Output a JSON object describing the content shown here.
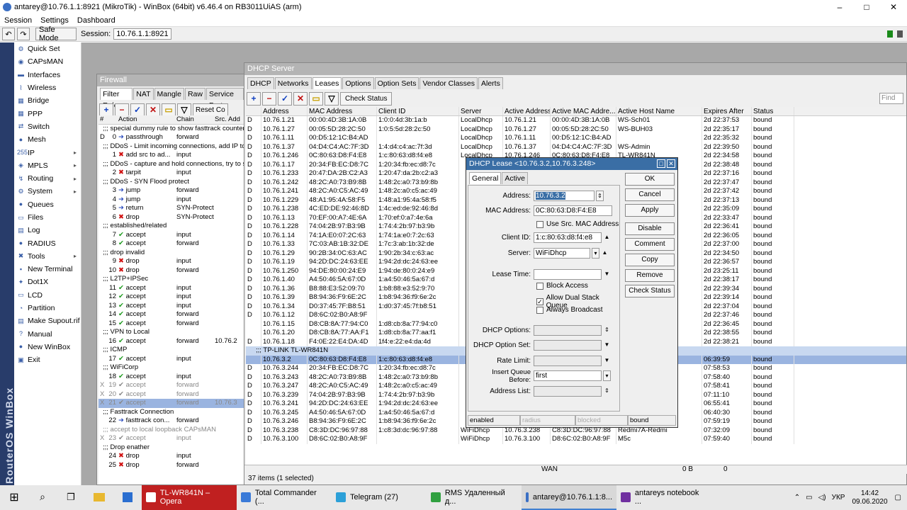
{
  "window": {
    "title": "antarey@10.76.1.1:8921 (MikroTik) - WinBox (64bit) v6.46.4 on RB3011UiAS (arm)",
    "minimize": "–",
    "maximize": "□",
    "close": "✕"
  },
  "menu": {
    "session": "Session",
    "settings": "Settings",
    "dashboard": "Dashboard"
  },
  "toolbar": {
    "undo": "↶",
    "redo": "↷",
    "safe_mode": "Safe Mode",
    "session_label": "Session:",
    "session_value": "10.76.1.1:8921"
  },
  "brand": "RouterOS WinBox",
  "sidebar": {
    "items": [
      {
        "label": "Quick Set",
        "icon": "quick-set-icon",
        "sym": "⚙"
      },
      {
        "label": "CAPsMAN",
        "icon": "capsman-icon",
        "sym": "◉"
      },
      {
        "label": "Interfaces",
        "icon": "interfaces-icon",
        "sym": "▬"
      },
      {
        "label": "Wireless",
        "icon": "wireless-icon",
        "sym": "⌇"
      },
      {
        "label": "Bridge",
        "icon": "bridge-icon",
        "sym": "▦"
      },
      {
        "label": "PPP",
        "icon": "ppp-icon",
        "sym": "▦"
      },
      {
        "label": "Switch",
        "icon": "switch-icon",
        "sym": "⇄"
      },
      {
        "label": "Mesh",
        "icon": "mesh-icon",
        "sym": "●"
      },
      {
        "label": "IP",
        "icon": "ip-icon",
        "sym": "255",
        "arrow": "▸"
      },
      {
        "label": "MPLS",
        "icon": "mpls-icon",
        "sym": "◈",
        "arrow": "▸"
      },
      {
        "label": "Routing",
        "icon": "routing-icon",
        "sym": "↯",
        "arrow": "▸"
      },
      {
        "label": "System",
        "icon": "system-icon",
        "sym": "⚙",
        "arrow": "▸"
      },
      {
        "label": "Queues",
        "icon": "queues-icon",
        "sym": "●"
      },
      {
        "label": "Files",
        "icon": "files-icon",
        "sym": "▭"
      },
      {
        "label": "Log",
        "icon": "log-icon",
        "sym": "▤"
      },
      {
        "label": "RADIUS",
        "icon": "radius-icon",
        "sym": "●"
      },
      {
        "label": "Tools",
        "icon": "tools-icon",
        "sym": "✖",
        "arrow": "▸"
      },
      {
        "label": "New Terminal",
        "icon": "terminal-icon",
        "sym": "▪"
      },
      {
        "label": "Dot1X",
        "icon": "dot1x-icon",
        "sym": "✦"
      },
      {
        "label": "LCD",
        "icon": "lcd-icon",
        "sym": "▭"
      },
      {
        "label": "Partition",
        "icon": "partition-icon",
        "sym": "◔"
      },
      {
        "label": "Make Supout.rif",
        "icon": "supout-icon",
        "sym": "▤"
      },
      {
        "label": "Manual",
        "icon": "manual-icon",
        "sym": "?"
      },
      {
        "label": "New WinBox",
        "icon": "new-winbox-icon",
        "sym": "●"
      },
      {
        "label": "Exit",
        "icon": "exit-icon",
        "sym": "▣"
      }
    ]
  },
  "firewall": {
    "title": "Firewall",
    "tabs": [
      "Filter Rules",
      "NAT",
      "Mangle",
      "Raw",
      "Service Ports"
    ],
    "reset": "Reset Co",
    "headers": {
      "hash": "#",
      "action": "Action",
      "chain": "Chain",
      "src": "Src. Add"
    },
    "rows": [
      {
        "kind": "comment",
        "text": ";;; special dummy rule to show fasttrack counters"
      },
      {
        "flag": "D",
        "num": "0",
        "action": "passthrough",
        "chain": "forward",
        "src": "",
        "cls": "act-other"
      },
      {
        "kind": "comment",
        "text": ";;; DDoS - Limit incoming connections, add IP to"
      },
      {
        "flag": "",
        "num": "1",
        "action": "add src to ad...",
        "chain": "input",
        "src": "",
        "cls": "act-drop"
      },
      {
        "kind": "comment",
        "text": ";;; DDoS - capture and hold connections, try to s"
      },
      {
        "flag": "",
        "num": "2",
        "action": "tarpit",
        "chain": "input",
        "src": "",
        "cls": "act-drop"
      },
      {
        "kind": "comment",
        "text": ";;; DDoS - SYN Flood protect"
      },
      {
        "flag": "",
        "num": "3",
        "action": "jump",
        "chain": "forward",
        "src": "",
        "cls": "act-other"
      },
      {
        "flag": "",
        "num": "4",
        "action": "jump",
        "chain": "input",
        "src": "",
        "cls": "act-other"
      },
      {
        "flag": "",
        "num": "5",
        "action": "return",
        "chain": "SYN-Protect",
        "src": "",
        "cls": "act-other"
      },
      {
        "flag": "",
        "num": "6",
        "action": "drop",
        "chain": "SYN-Protect",
        "src": "",
        "cls": "act-drop"
      },
      {
        "kind": "comment",
        "text": ";;; established/related"
      },
      {
        "flag": "",
        "num": "7",
        "action": "accept",
        "chain": "input",
        "src": "",
        "cls": "act-acc"
      },
      {
        "flag": "",
        "num": "8",
        "action": "accept",
        "chain": "forward",
        "src": "",
        "cls": "act-acc"
      },
      {
        "kind": "comment",
        "text": ";;; drop invalid"
      },
      {
        "flag": "",
        "num": "9",
        "action": "drop",
        "chain": "input",
        "src": "",
        "cls": "act-drop"
      },
      {
        "flag": "",
        "num": "10",
        "action": "drop",
        "chain": "forward",
        "src": "",
        "cls": "act-drop"
      },
      {
        "kind": "comment",
        "text": ";;; L2TP+IPSec"
      },
      {
        "flag": "",
        "num": "11",
        "action": "accept",
        "chain": "input",
        "src": "",
        "cls": "act-acc"
      },
      {
        "flag": "",
        "num": "12",
        "action": "accept",
        "chain": "input",
        "src": "",
        "cls": "act-acc"
      },
      {
        "flag": "",
        "num": "13",
        "action": "accept",
        "chain": "input",
        "src": "",
        "cls": "act-acc"
      },
      {
        "flag": "",
        "num": "14",
        "action": "accept",
        "chain": "forward",
        "src": "",
        "cls": "act-acc"
      },
      {
        "flag": "",
        "num": "15",
        "action": "accept",
        "chain": "forward",
        "src": "",
        "cls": "act-acc"
      },
      {
        "kind": "comment",
        "text": ";;; VPN to Local"
      },
      {
        "flag": "",
        "num": "16",
        "action": "accept",
        "chain": "forward",
        "src": "10.76.2",
        "cls": "act-acc"
      },
      {
        "kind": "comment",
        "text": ";;; ICMP"
      },
      {
        "flag": "",
        "num": "17",
        "action": "accept",
        "chain": "input",
        "src": "",
        "cls": "act-acc"
      },
      {
        "kind": "comment",
        "text": ";;; WiFiCorp"
      },
      {
        "flag": "",
        "num": "18",
        "action": "accept",
        "chain": "input",
        "src": "",
        "cls": "act-acc"
      },
      {
        "flag": "X",
        "num": "19",
        "action": "accept",
        "chain": "forward",
        "src": "",
        "cls": "act-acc",
        "disabled": true
      },
      {
        "flag": "X",
        "num": "20",
        "action": "accept",
        "chain": "forward",
        "src": "",
        "cls": "act-acc",
        "disabled": true
      },
      {
        "flag": "X",
        "num": "21",
        "action": "accept",
        "chain": "forward",
        "src": "10.76.3",
        "cls": "act-acc",
        "disabled": true,
        "selected": true
      },
      {
        "kind": "comment",
        "text": ";;; Fasttrack Connection"
      },
      {
        "flag": "",
        "num": "22",
        "action": "fasttrack con...",
        "chain": "forward",
        "src": "",
        "cls": "act-other"
      },
      {
        "kind": "comment",
        "text": ";;; accept to local loopback CAPsMAN",
        "disabled": true
      },
      {
        "flag": "X",
        "num": "23",
        "action": "accept",
        "chain": "input",
        "src": "",
        "cls": "act-acc",
        "disabled": true
      },
      {
        "kind": "comment",
        "text": ";;; Drop enather"
      },
      {
        "flag": "",
        "num": "24",
        "action": "drop",
        "chain": "input",
        "src": "",
        "cls": "act-drop"
      },
      {
        "flag": "",
        "num": "25",
        "action": "drop",
        "chain": "forward",
        "src": "",
        "cls": "act-drop"
      }
    ]
  },
  "dhcp": {
    "title": "DHCP Server",
    "tabs": [
      "DHCP",
      "Networks",
      "Leases",
      "Options",
      "Option Sets",
      "Vendor Classes",
      "Alerts"
    ],
    "active_tab": "Leases",
    "check_status": "Check Status",
    "find": "Find",
    "headers": [
      "",
      "Address",
      "MAC Address",
      "Client ID",
      "Server",
      "Active Address",
      "Active MAC Addre...",
      "Active Host Name",
      "Expires After",
      "Status"
    ],
    "rows": [
      [
        "D",
        "10.76.1.21",
        "00:00:4D:3B:1A:0B",
        "1:0:0:4d:3b:1a:b",
        "LocalDhcp",
        "10.76.1.21",
        "00:00:4D:3B:1A:0B",
        "WS-Sch01",
        "2d 22:37:53",
        "bound"
      ],
      [
        "D",
        "10.76.1.27",
        "00:05:5D:28:2C:50",
        "1:0:5:5d:28:2c:50",
        "LocalDhcp",
        "10.76.1.27",
        "00:05:5D:28:2C:50",
        "WS-BUH03",
        "2d 22:35:17",
        "bound"
      ],
      [
        "D",
        "10.76.1.11",
        "00:D5:12:1C:B4:AD",
        "",
        "LocalDhcp",
        "10.76.1.11",
        "00:D5:12:1C:B4:AD",
        "",
        "2d 22:35:32",
        "bound"
      ],
      [
        "D",
        "10.76.1.37",
        "04:D4:C4:AC:7F:3D",
        "1:4:d4:c4:ac:7f:3d",
        "LocalDhcp",
        "10.76.1.37",
        "04:D4:C4:AC:7F:3D",
        "WS-Admin",
        "2d 22:39:50",
        "bound"
      ],
      [
        "D",
        "10.76.1.246",
        "0C:80:63:D8:F4:E8",
        "1:c:80:63:d8:f4:e8",
        "LocalDhcp",
        "10.76.1.246",
        "0C:80:63:D8:F4:E8",
        "TL-WR841N",
        "2d 22:34:58",
        "bound"
      ],
      [
        "D",
        "10.76.1.17",
        "20:34:FB:EC:D8:7C",
        "1:20:34:fb:ec:d8:7c",
        "",
        "",
        "",
        "",
        "2d 22:38:48",
        "bound"
      ],
      [
        "D",
        "10.76.1.233",
        "20:47:DA:2B:C2:A3",
        "1:20:47:da:2b:c2:a3",
        "",
        "",
        "",
        "",
        "2d 22:37:16",
        "bound"
      ],
      [
        "D",
        "10.76.1.242",
        "48:2C:A0:73:B9:8B",
        "1:48:2c:a0:73:b9:8b",
        "",
        "",
        "",
        "",
        "2d 22:37:47",
        "bound"
      ],
      [
        "D",
        "10.76.1.241",
        "48:2C:A0:C5:AC:49",
        "1:48:2c:a0:c5:ac:49",
        "",
        "",
        "",
        "mi",
        "2d 22:37:42",
        "bound"
      ],
      [
        "D",
        "10.76.1.229",
        "48:A1:95:4A:58:F5",
        "1:48:a1:95:4a:58:f5",
        "",
        "",
        "",
        "",
        "2d 22:37:13",
        "bound"
      ],
      [
        "D",
        "10.76.1.238",
        "4C:ED:DE:92:46:8D",
        "1:4c:ed:de:92:46:8d",
        "",
        "",
        "",
        "",
        "2d 22:35:09",
        "bound"
      ],
      [
        "D",
        "10.76.1.13",
        "70:EF:00:A7:4E:6A",
        "1:70:ef:0:a7:4e:6a",
        "",
        "",
        "",
        "",
        "2d 22:33:47",
        "bound"
      ],
      [
        "D",
        "10.76.1.228",
        "74:04:2B:97:B3:9B",
        "1:74:4:2b:97:b3:9b",
        "",
        "",
        "",
        "8e1037",
        "2d 22:36:41",
        "bound"
      ],
      [
        "D",
        "10.76.1.14",
        "74:1A:E0:07:2C:63",
        "1:74:1a:e0:7:2c:63",
        "",
        "",
        "",
        "3f7956",
        "2d 22:36:05",
        "bound"
      ],
      [
        "D",
        "10.76.1.33",
        "7C:03:AB:1B:32:DE",
        "1:7c:3:ab:1b:32:de",
        "",
        "",
        "",
        "",
        "2d 22:37:00",
        "bound"
      ],
      [
        "D",
        "10.76.1.29",
        "90:2B:34:0C:63:AC",
        "1:90:2b:34:c:63:ac",
        "",
        "",
        "",
        "",
        "2d 22:34:50",
        "bound"
      ],
      [
        "D",
        "10.76.1.19",
        "94:2D:DC:24:63:EE",
        "1:94:2d:dc:24:63:ee",
        "",
        "",
        "",
        "",
        "2d 22:36:57",
        "bound"
      ],
      [
        "D",
        "10.76.1.250",
        "94:DE:80:00:24:E9",
        "1:94:de:80:0:24:e9",
        "",
        "",
        "",
        "",
        "2d 23:25:11",
        "bound"
      ],
      [
        "D",
        "10.76.1.40",
        "A4:50:46:5A:67:0D",
        "1:a4:50:46:5a:67:d",
        "",
        "",
        "",
        "",
        "2d 22:38:17",
        "bound"
      ],
      [
        "D",
        "10.76.1.36",
        "B8:88:E3:52:09:70",
        "1:b8:88:e3:52:9:70",
        "",
        "",
        "",
        "",
        "2d 22:39:34",
        "bound"
      ],
      [
        "D",
        "10.76.1.39",
        "B8:94:36:F9:6E:2C",
        "1:b8:94:36:f9:6e:2c",
        "",
        "",
        "",
        "37682...",
        "2d 22:39:14",
        "bound"
      ],
      [
        "D",
        "10.76.1.34",
        "D0:37:45:7F:B8:51",
        "1:d0:37:45:7f:b8:51",
        "",
        "",
        "",
        "",
        "2d 22:37:04",
        "bound"
      ],
      [
        "D",
        "10.76.1.12",
        "D8:6C:02:B0:A8:9F",
        "",
        "",
        "",
        "",
        "",
        "2d 22:37:46",
        "bound"
      ],
      [
        "",
        "10.76.1.15",
        "D8:CB:8A:77:94:C0",
        "1:d8:cb:8a:77:94:c0",
        "",
        "",
        "",
        "",
        "2d 22:36:45",
        "bound"
      ],
      [
        "",
        "10.76.1.20",
        "D8:CB:8A:77:AA:F1",
        "1:d8:cb:8a:77:aa:f1",
        "",
        "",
        "",
        "",
        "2d 22:38:55",
        "bound"
      ],
      [
        "D",
        "10.76.1.18",
        "F4:0E:22:E4:DA:4D",
        "1f4:e:22:e4:da:4d",
        "",
        "",
        "",
        "13c372",
        "2d 22:38:21",
        "bound"
      ]
    ],
    "group": ";;; TP-LINK TL-WR841N",
    "rows2": [
      [
        "",
        "10.76.3.2",
        "0C:80:63:D8:F4:E8",
        "1:c:80:63:d8:f4:e8",
        "",
        "",
        "",
        "",
        "06:39:59",
        "bound",
        "sel"
      ],
      [
        "D",
        "10.76.3.244",
        "20:34:FB:EC:D8:7C",
        "1:20:34:fb:ec:d8:7c",
        "",
        "",
        "",
        "",
        "07:58:53",
        "bound",
        ""
      ],
      [
        "D",
        "10.76.3.243",
        "48:2C:A0:73:B9:8B",
        "1:48:2c:a0:73:b9:8b",
        "",
        "",
        "",
        "",
        "07:58:40",
        "bound",
        ""
      ],
      [
        "D",
        "10.76.3.247",
        "48:2C:A0:C5:AC:49",
        "1:48:2c:a0:c5:ac:49",
        "",
        "",
        "",
        "mi",
        "07:58:41",
        "bound",
        ""
      ],
      [
        "D",
        "10.76.3.239",
        "74:04:2B:97:B3:9B",
        "1:74:4:2b:97:b3:9b",
        "",
        "",
        "",
        "8e1037",
        "07:11:10",
        "bound",
        ""
      ],
      [
        "D",
        "10.76.3.241",
        "94:2D:DC:24:63:EE",
        "1:94:2d:dc:24:63:ee",
        "",
        "",
        "",
        "",
        "06:55:41",
        "bound",
        ""
      ],
      [
        "D",
        "10.76.3.245",
        "A4:50:46:5A:67:0D",
        "1:a4:50:46:5a:67:d",
        "",
        "",
        "",
        "",
        "06:40:30",
        "bound",
        ""
      ],
      [
        "D",
        "10.76.3.246",
        "B8:94:36:F9:6E:2C",
        "1:b8:94:36:f9:6e:2c",
        "",
        "",
        "",
        "37682...",
        "07:59:19",
        "bound",
        ""
      ],
      [
        "D",
        "10.76.3.238",
        "C8:3D:DC:96:97:88",
        "1:c8:3d:dc:96:97:88",
        "WiFiDhcp",
        "10.76.3.238",
        "C8:3D:DC:96:97:88",
        "Redmi7A-Redmi",
        "07:32:09",
        "bound",
        ""
      ],
      [
        "D",
        "10.76.3.100",
        "D8:6C:02:B0:A8:9F",
        "",
        "WiFiDhcp",
        "10.76.3.100",
        "D8:6C:02:B0:A8:9F",
        "M5c",
        "07:59:40",
        "bound",
        ""
      ]
    ],
    "status": "37 items (1 selected)",
    "footer_wan": "WAN",
    "footer_b": "0 B",
    "footer_z": "0"
  },
  "lease": {
    "title": "DHCP Lease <10.76.3.2,10.76.3.248>",
    "tabs": [
      "General",
      "Active"
    ],
    "address_label": "Address:",
    "address": "10.76.3.2",
    "mac_label": "MAC Address:",
    "mac": "0C:80:63:D8:F4:E8",
    "use_src_mac": "Use Src. MAC Address",
    "client_id_label": "Client ID:",
    "client_id": "1:c:80:63:d8:f4:e8",
    "server_label": "Server:",
    "server": "WiFiDhcp",
    "lease_time_label": "Lease Time:",
    "block_access": "Block Access",
    "allow_dual": "Allow Dual Stack Queue",
    "always_broadcast": "Always Broadcast",
    "dhcp_options_label": "DHCP Options:",
    "dhcp_option_set_label": "DHCP Option Set:",
    "rate_limit_label": "Rate Limit:",
    "insert_queue_label": "Insert Queue Before:",
    "insert_queue": "first",
    "address_list_label": "Address List:",
    "buttons": [
      "OK",
      "Cancel",
      "Apply",
      "Disable",
      "Comment",
      "Copy",
      "Remove",
      "Check Status"
    ],
    "status": [
      "enabled",
      "radius",
      "blocked",
      "bound"
    ]
  },
  "taskbar": {
    "items": [
      {
        "label": "TL-WR841N – Opera",
        "color": "#e0241c"
      },
      {
        "label": "Total Commander (...",
        "color": "#3a7ad8"
      },
      {
        "label": "Telegram (27)",
        "color": "#2ca0d8"
      },
      {
        "label": "RMS Удаленный д...",
        "color": "#30a040"
      },
      {
        "label": "antarey@10.76.1.1:8...",
        "color": "#3a6fc4"
      },
      {
        "label": "antareys notebook ...",
        "color": "#7030a0"
      }
    ],
    "lang": "УКР",
    "time": "14:42",
    "date": "09.06.2020"
  }
}
